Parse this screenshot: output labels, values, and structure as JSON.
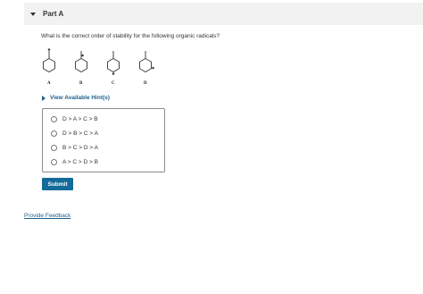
{
  "part": {
    "title": "Part A"
  },
  "question": {
    "text": "What is the correct order of stability for the following organic radicals?"
  },
  "molecules": [
    {
      "label": "A"
    },
    {
      "label": "B"
    },
    {
      "label": "C"
    },
    {
      "label": "D"
    }
  ],
  "hints": {
    "label": "View Available Hint(s)"
  },
  "options": [
    {
      "label": "D > A > C > B",
      "selected": false
    },
    {
      "label": "D > B > C > A",
      "selected": false
    },
    {
      "label": "B > C > D > A",
      "selected": false
    },
    {
      "label": "A > C > D > B",
      "selected": false
    }
  ],
  "submit": {
    "label": "Submit"
  },
  "feedback": {
    "label": "Provide Feedback"
  },
  "colors": {
    "accent": "#136b99",
    "link": "#1f5f8b",
    "header_bg": "#f2f2f2"
  }
}
